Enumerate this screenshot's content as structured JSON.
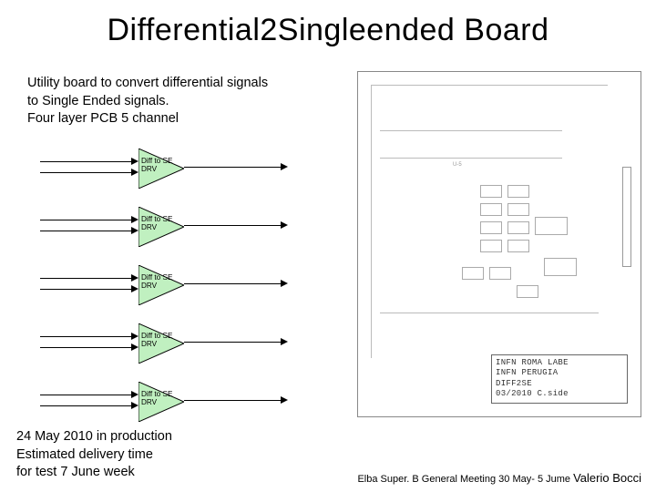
{
  "title": "Differential2Singleended  Board",
  "description": {
    "line1": "Utility board to convert differential signals",
    "line2": "to Single Ended signals.",
    "line3": "Four layer PCB 5 channel"
  },
  "driver_label": {
    "line1": "Diff to SE",
    "line2": "DRV"
  },
  "bottom_note": {
    "line1": "24 May  2010 in production",
    "line2": "Estimated delivery time",
    "line3": "for test 7 June week"
  },
  "footer": {
    "meeting": "Elba  Super. B  General Meeting  30 May- 5 Jume ",
    "author": "Valerio Bocci"
  },
  "pcb_titleblock": {
    "line1": "INFN ROMA LABE",
    "line2": "INFN PERUGIA",
    "line3": "DIFF2SE",
    "line4": "03/2010 C.side"
  }
}
